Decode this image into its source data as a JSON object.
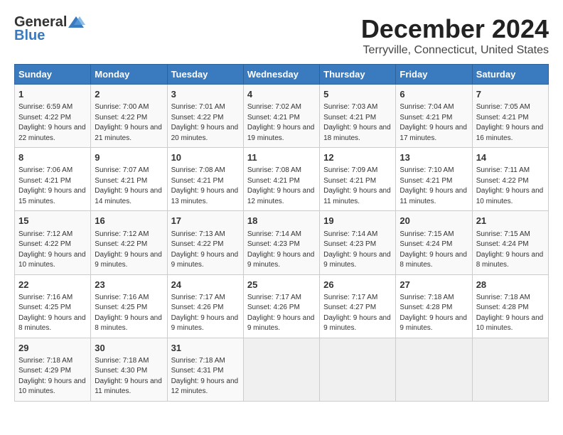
{
  "header": {
    "logo_general": "General",
    "logo_blue": "Blue",
    "month": "December 2024",
    "location": "Terryville, Connecticut, United States"
  },
  "weekdays": [
    "Sunday",
    "Monday",
    "Tuesday",
    "Wednesday",
    "Thursday",
    "Friday",
    "Saturday"
  ],
  "weeks": [
    [
      {
        "day": "1",
        "sunrise": "6:59 AM",
        "sunset": "4:22 PM",
        "daylight": "9 hours and 22 minutes."
      },
      {
        "day": "2",
        "sunrise": "7:00 AM",
        "sunset": "4:22 PM",
        "daylight": "9 hours and 21 minutes."
      },
      {
        "day": "3",
        "sunrise": "7:01 AM",
        "sunset": "4:22 PM",
        "daylight": "9 hours and 20 minutes."
      },
      {
        "day": "4",
        "sunrise": "7:02 AM",
        "sunset": "4:21 PM",
        "daylight": "9 hours and 19 minutes."
      },
      {
        "day": "5",
        "sunrise": "7:03 AM",
        "sunset": "4:21 PM",
        "daylight": "9 hours and 18 minutes."
      },
      {
        "day": "6",
        "sunrise": "7:04 AM",
        "sunset": "4:21 PM",
        "daylight": "9 hours and 17 minutes."
      },
      {
        "day": "7",
        "sunrise": "7:05 AM",
        "sunset": "4:21 PM",
        "daylight": "9 hours and 16 minutes."
      }
    ],
    [
      {
        "day": "8",
        "sunrise": "7:06 AM",
        "sunset": "4:21 PM",
        "daylight": "9 hours and 15 minutes."
      },
      {
        "day": "9",
        "sunrise": "7:07 AM",
        "sunset": "4:21 PM",
        "daylight": "9 hours and 14 minutes."
      },
      {
        "day": "10",
        "sunrise": "7:08 AM",
        "sunset": "4:21 PM",
        "daylight": "9 hours and 13 minutes."
      },
      {
        "day": "11",
        "sunrise": "7:08 AM",
        "sunset": "4:21 PM",
        "daylight": "9 hours and 12 minutes."
      },
      {
        "day": "12",
        "sunrise": "7:09 AM",
        "sunset": "4:21 PM",
        "daylight": "9 hours and 11 minutes."
      },
      {
        "day": "13",
        "sunrise": "7:10 AM",
        "sunset": "4:21 PM",
        "daylight": "9 hours and 11 minutes."
      },
      {
        "day": "14",
        "sunrise": "7:11 AM",
        "sunset": "4:22 PM",
        "daylight": "9 hours and 10 minutes."
      }
    ],
    [
      {
        "day": "15",
        "sunrise": "7:12 AM",
        "sunset": "4:22 PM",
        "daylight": "9 hours and 10 minutes."
      },
      {
        "day": "16",
        "sunrise": "7:12 AM",
        "sunset": "4:22 PM",
        "daylight": "9 hours and 9 minutes."
      },
      {
        "day": "17",
        "sunrise": "7:13 AM",
        "sunset": "4:22 PM",
        "daylight": "9 hours and 9 minutes."
      },
      {
        "day": "18",
        "sunrise": "7:14 AM",
        "sunset": "4:23 PM",
        "daylight": "9 hours and 9 minutes."
      },
      {
        "day": "19",
        "sunrise": "7:14 AM",
        "sunset": "4:23 PM",
        "daylight": "9 hours and 9 minutes."
      },
      {
        "day": "20",
        "sunrise": "7:15 AM",
        "sunset": "4:24 PM",
        "daylight": "9 hours and 8 minutes."
      },
      {
        "day": "21",
        "sunrise": "7:15 AM",
        "sunset": "4:24 PM",
        "daylight": "9 hours and 8 minutes."
      }
    ],
    [
      {
        "day": "22",
        "sunrise": "7:16 AM",
        "sunset": "4:25 PM",
        "daylight": "9 hours and 8 minutes."
      },
      {
        "day": "23",
        "sunrise": "7:16 AM",
        "sunset": "4:25 PM",
        "daylight": "9 hours and 8 minutes."
      },
      {
        "day": "24",
        "sunrise": "7:17 AM",
        "sunset": "4:26 PM",
        "daylight": "9 hours and 9 minutes."
      },
      {
        "day": "25",
        "sunrise": "7:17 AM",
        "sunset": "4:26 PM",
        "daylight": "9 hours and 9 minutes."
      },
      {
        "day": "26",
        "sunrise": "7:17 AM",
        "sunset": "4:27 PM",
        "daylight": "9 hours and 9 minutes."
      },
      {
        "day": "27",
        "sunrise": "7:18 AM",
        "sunset": "4:28 PM",
        "daylight": "9 hours and 9 minutes."
      },
      {
        "day": "28",
        "sunrise": "7:18 AM",
        "sunset": "4:28 PM",
        "daylight": "9 hours and 10 minutes."
      }
    ],
    [
      {
        "day": "29",
        "sunrise": "7:18 AM",
        "sunset": "4:29 PM",
        "daylight": "9 hours and 10 minutes."
      },
      {
        "day": "30",
        "sunrise": "7:18 AM",
        "sunset": "4:30 PM",
        "daylight": "9 hours and 11 minutes."
      },
      {
        "day": "31",
        "sunrise": "7:18 AM",
        "sunset": "4:31 PM",
        "daylight": "9 hours and 12 minutes."
      },
      null,
      null,
      null,
      null
    ]
  ]
}
